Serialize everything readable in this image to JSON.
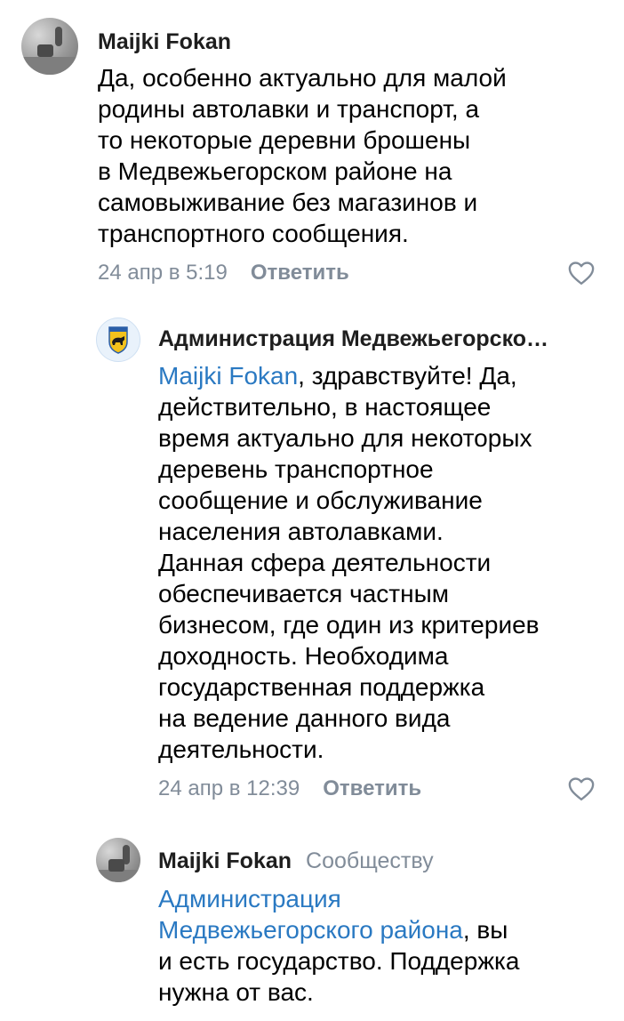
{
  "comments": [
    {
      "author": "Maijki Fokan",
      "avatar": "user-photo",
      "lines": [
        "Да, особенно актуально для малой",
        "родины автолавки и транспорт, а",
        "то некоторые деревни брошены",
        "в Медвежьегорском районе на",
        "самовыживание без магазинов и",
        "транспортного сообщения."
      ],
      "time": "24 апр в 5:19",
      "reply": "Ответить",
      "like_icon": "heart-outline-icon"
    },
    {
      "author": "Администрация Медвежьегорско…",
      "avatar": "coat-of-arms-emblem",
      "mention": "Maijki Fokan",
      "first_line_rest": ", здравствуйте! Да,",
      "lines": [
        "действительно, в настоящее",
        "время актуально для некоторых",
        "деревень транспортное",
        "сообщение и обслуживание",
        "населения автолавками.",
        "Данная сфера  деятельности",
        "обеспечивается частным",
        "бизнесом, где один из критериев",
        "доходность. Необходима",
        "государственная поддержка",
        "на ведение данного вида",
        "деятельности."
      ],
      "time": "24 апр в 12:39",
      "reply": "Ответить",
      "like_icon": "heart-outline-icon"
    },
    {
      "author": "Maijki Fokan",
      "reply_to": "Сообществу",
      "avatar": "user-photo",
      "mention_lines": [
        "Администрация",
        "Медвежьегорского района"
      ],
      "mention_tail": ", вы",
      "lines": [
        "и есть государство. Поддержка",
        "нужна от вас."
      ]
    }
  ],
  "colors": {
    "mention": "#2a79c2",
    "meta": "#818c99"
  }
}
